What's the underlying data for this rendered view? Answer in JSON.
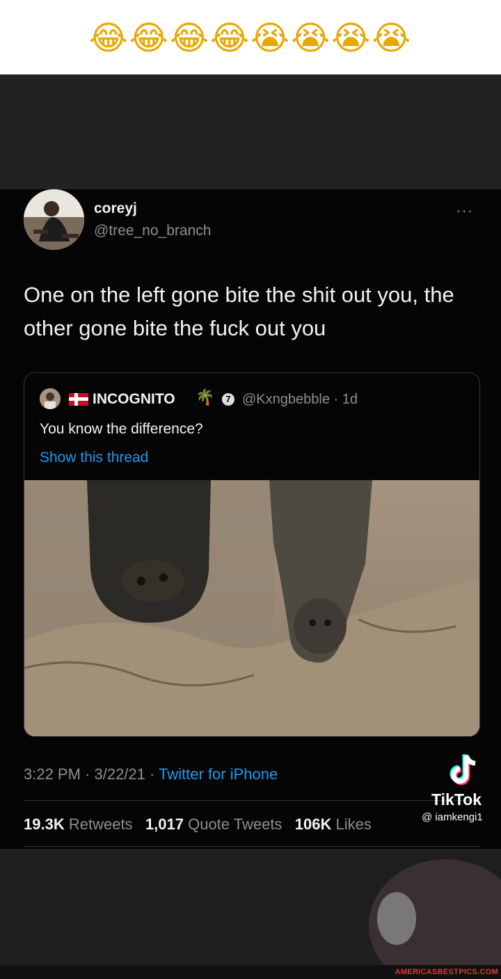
{
  "caption": {
    "emojis": "😂😂😂😂😭😭😭😭"
  },
  "tweet": {
    "display_name": "coreyj",
    "handle": "@tree_no_branch",
    "more_label": "···",
    "text": "One on the left gone bite the shit out you, the other gone bite the fuck out you",
    "quote": {
      "name": "INCOGNITO",
      "palm": "🌴",
      "badge": "7",
      "handle_time": "@Kxngbebble · 1d",
      "text": "You know the difference?",
      "show_thread": "Show this thread"
    },
    "time": "3:22 PM · 3/22/21 · ",
    "source": "Twitter for iPhone",
    "stats": {
      "retweets_count": "19.3K",
      "retweets_label": "Retweets",
      "quotes_count": "1,017",
      "quotes_label": "Quote Tweets",
      "likes_count": "106K",
      "likes_label": "Likes"
    }
  },
  "tiktok": {
    "name": "TikTok",
    "user": "@ iamkengi1"
  },
  "watermark": "AMERICASBESTPICS.COM"
}
